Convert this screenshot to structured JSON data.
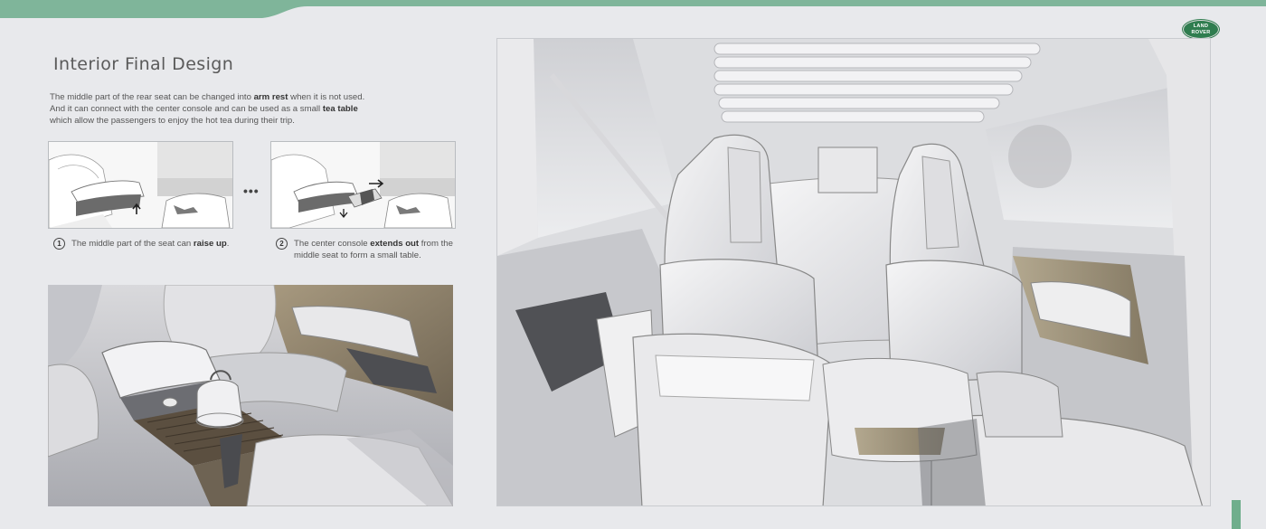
{
  "brand": {
    "logo_line1": "LAND",
    "logo_line2": "ROVER",
    "accent_color": "#7fb59a",
    "logo_color": "#2f7d4f"
  },
  "page": {
    "title": "Interior Final Design"
  },
  "description": {
    "line1_pre": "The middle part of the rear seat can be changed into ",
    "line1_bold": "arm rest",
    "line1_post": " when it is not used.",
    "line2_pre": "And it can connect with the center console and can be used as a small ",
    "line2_bold": "tea table",
    "line3": "which allow the passengers to enjoy the hot tea during their trip."
  },
  "steps": [
    {
      "number": "1",
      "text_pre": "The middle part of the seat can ",
      "text_bold": "raise up",
      "text_post": "."
    },
    {
      "number": "2",
      "text_pre": "The center console ",
      "text_bold": "extends out",
      "text_post": " from the",
      "text_line2": "middle seat to form a small table."
    }
  ],
  "separator": "•••"
}
